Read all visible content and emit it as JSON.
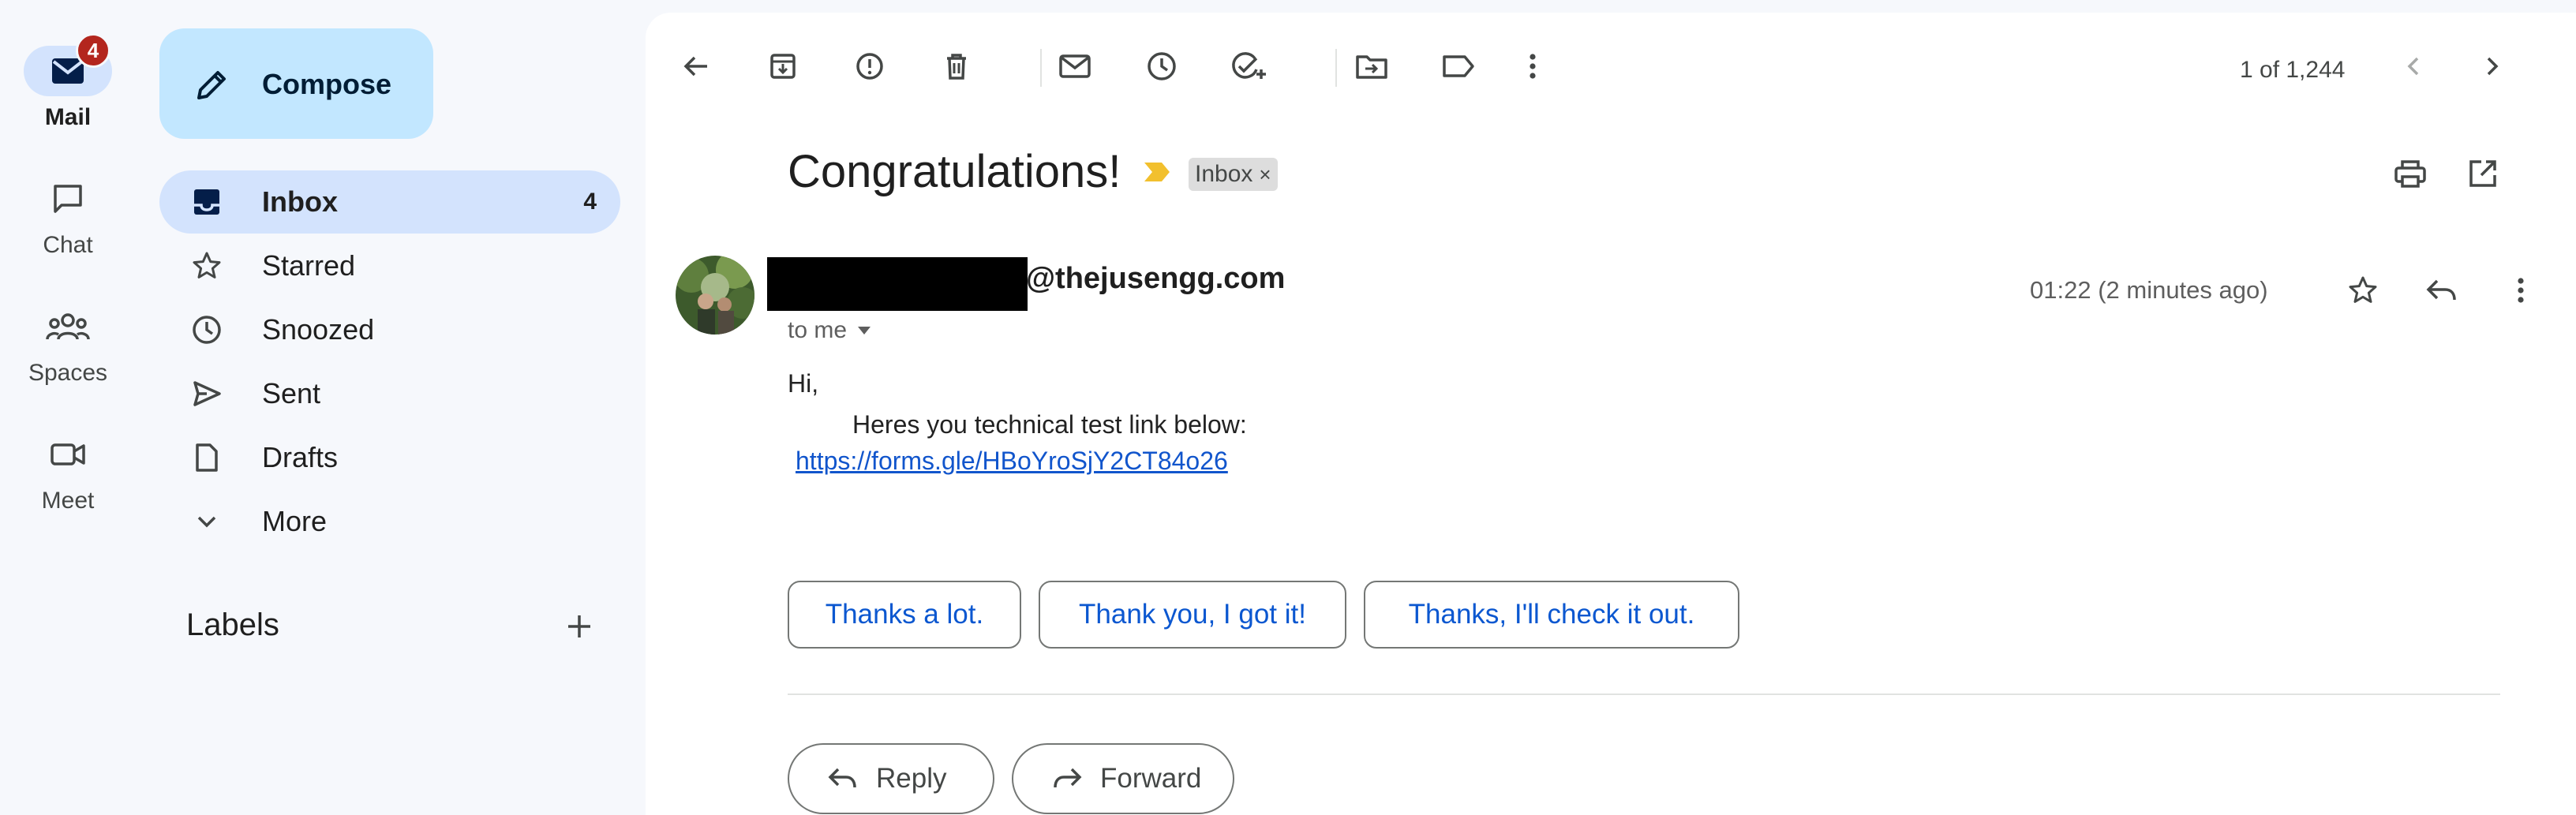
{
  "rail": {
    "items": [
      {
        "label": "Mail",
        "icon": "mail-icon",
        "badge": "4",
        "active": true
      },
      {
        "label": "Chat",
        "icon": "chat-icon"
      },
      {
        "label": "Spaces",
        "icon": "spaces-icon"
      },
      {
        "label": "Meet",
        "icon": "meet-icon"
      }
    ]
  },
  "compose": {
    "label": "Compose",
    "icon": "pencil-icon"
  },
  "nav": {
    "items": [
      {
        "label": "Inbox",
        "icon": "inbox-icon",
        "count": "4",
        "active": true
      },
      {
        "label": "Starred",
        "icon": "star-icon"
      },
      {
        "label": "Snoozed",
        "icon": "clock-icon"
      },
      {
        "label": "Sent",
        "icon": "send-icon"
      },
      {
        "label": "Drafts",
        "icon": "draft-icon"
      },
      {
        "label": "More",
        "icon": "chevron-down-icon"
      }
    ]
  },
  "labels": {
    "heading": "Labels",
    "add_icon": "plus-icon"
  },
  "toolbar": {
    "pager": "1 of 1,244",
    "icons": [
      "back-arrow-icon",
      "archive-icon",
      "report-spam-icon",
      "delete-icon",
      "mark-unread-icon",
      "snooze-icon",
      "add-to-tasks-icon",
      "move-to-icon",
      "label-icon",
      "more-vert-icon",
      "prev-icon",
      "next-icon"
    ]
  },
  "email": {
    "subject": "Congratulations!",
    "label_chip": "Inbox",
    "chip_close": "×",
    "sender_domain": "@thejusengg.com",
    "to": "to me",
    "time": "01:22 (2 minutes ago)",
    "greeting": "Hi,",
    "line": "Heres you technical test link below:",
    "link": "https://forms.gle/HBoYroSjY2CT84o26"
  },
  "smart_replies": [
    "Thanks a lot.",
    "Thank you, I got it!",
    "Thanks, I'll check it out."
  ],
  "actions": {
    "reply": "Reply",
    "forward": "Forward"
  },
  "colors": {
    "accent": "#0b57d0",
    "active_bg": "#d3e3fd",
    "compose_bg": "#c2e7ff",
    "badge": "#b3261e",
    "importance": "#f2c02e"
  }
}
